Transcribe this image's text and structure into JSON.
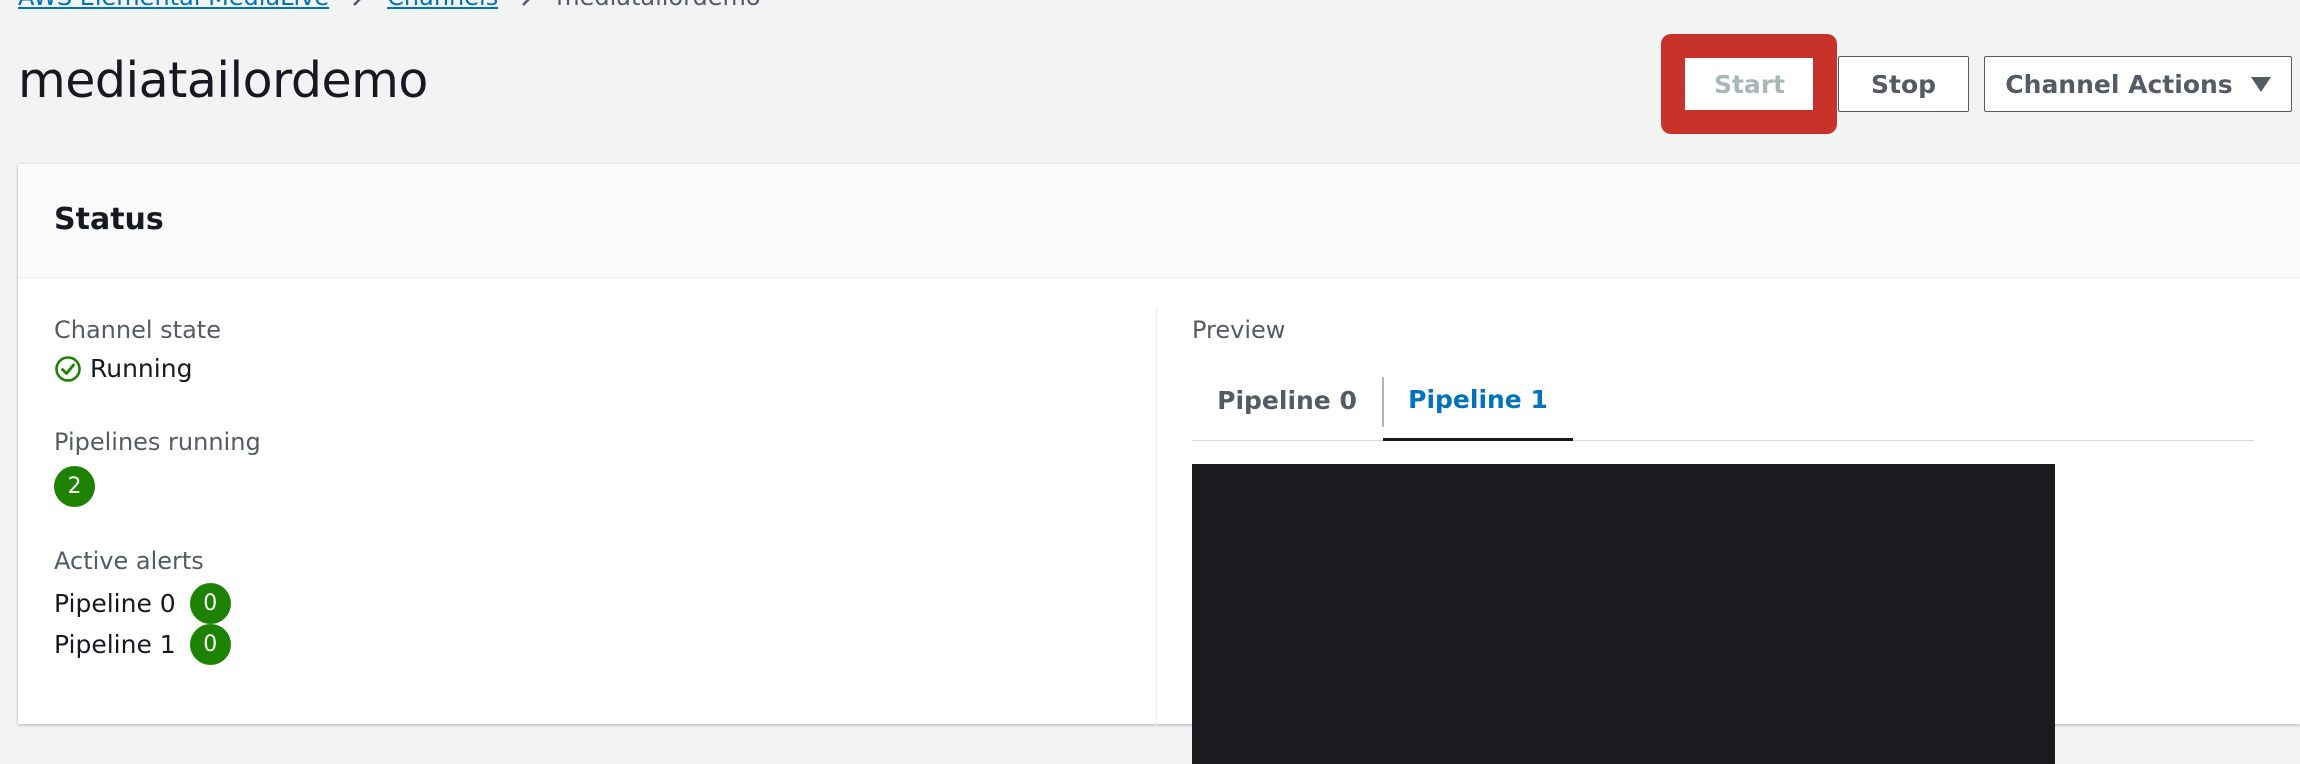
{
  "breadcrumb": {
    "items": [
      "AWS Elemental MediaLive",
      "Channels"
    ],
    "current": "mediatailordemo"
  },
  "page": {
    "title": "mediatailordemo"
  },
  "header_actions": {
    "start_label": "Start",
    "stop_label": "Stop",
    "channel_actions_label": "Channel Actions"
  },
  "status": {
    "title": "Status",
    "channel_state_label": "Channel state",
    "channel_state_value": "Running",
    "pipelines_running_label": "Pipelines running",
    "pipelines_running_value": "2",
    "active_alerts_label": "Active alerts",
    "alerts": [
      {
        "name": "Pipeline 0",
        "count": "0"
      },
      {
        "name": "Pipeline 1",
        "count": "0"
      }
    ]
  },
  "preview": {
    "label": "Preview",
    "tabs": [
      "Pipeline 0",
      "Pipeline 1"
    ],
    "active_tab": "Pipeline 1"
  },
  "colors": {
    "success": "#1d8102",
    "link": "#0073bb",
    "highlight": "#c7322b",
    "preview_bg": "#1a1b1f"
  },
  "icons": {
    "status": "check-circle-icon",
    "breadcrumb_separator": "chevron-right-icon",
    "dropdown": "caret-down-icon"
  }
}
